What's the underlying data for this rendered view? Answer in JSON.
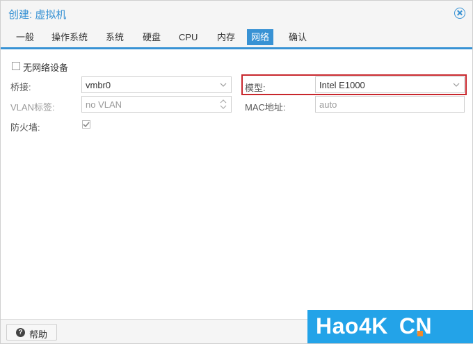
{
  "window": {
    "title": "创建: 虚拟机"
  },
  "tabs": [
    {
      "label": "一般"
    },
    {
      "label": "操作系统"
    },
    {
      "label": "系统"
    },
    {
      "label": "硬盘"
    },
    {
      "label": "CPU"
    },
    {
      "label": "内存"
    },
    {
      "label": "网络",
      "active": true
    },
    {
      "label": "确认"
    }
  ],
  "form": {
    "no_network": {
      "label": "无网络设备",
      "checked": false
    },
    "bridge": {
      "label": "桥接:",
      "value": "vmbr0"
    },
    "vlan": {
      "label": "VLAN标签:",
      "value": "no VLAN"
    },
    "firewall": {
      "label": "防火墙:",
      "checked": true
    },
    "model": {
      "label": "模型:",
      "value": "Intel E1000"
    },
    "mac": {
      "label": "MAC地址:",
      "value": "auto"
    }
  },
  "footer": {
    "help_label": "帮助"
  },
  "watermark": {
    "text": "Hao4K CN"
  },
  "colors": {
    "accent": "#3892d4",
    "highlight": "#c8262c",
    "watermark_bg": "#23a3e8",
    "watermark_dot": "#f08a2a"
  }
}
